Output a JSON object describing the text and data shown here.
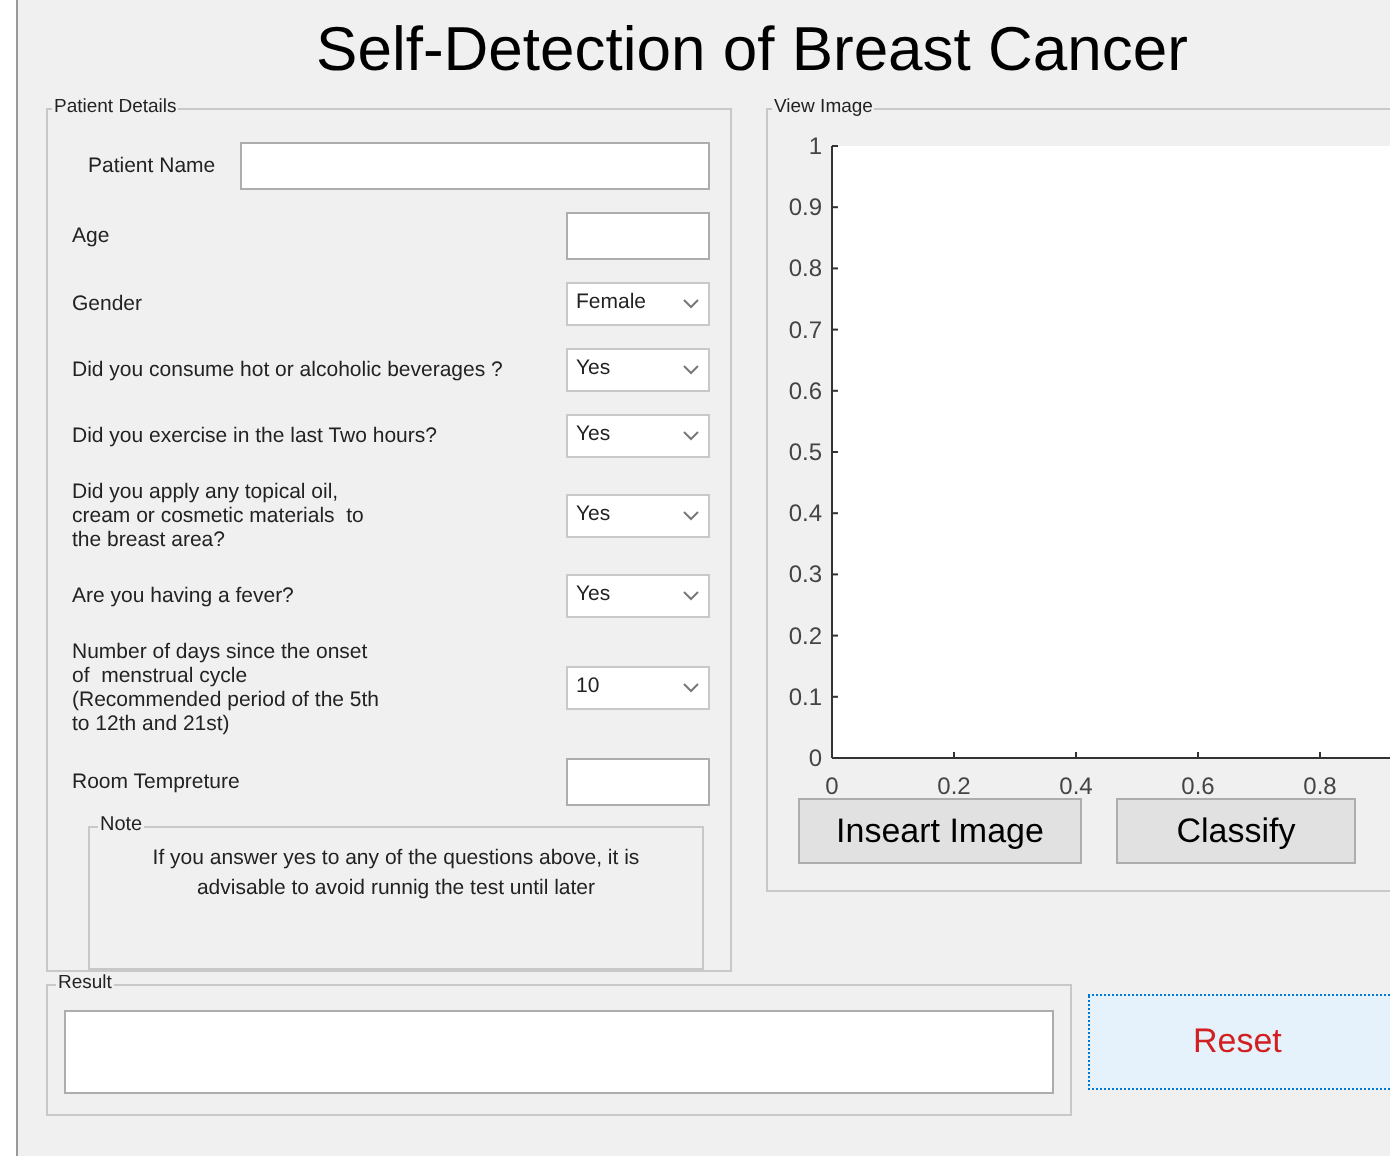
{
  "title": "Self-Detection of Breast Cancer",
  "patient_details": {
    "title": "Patient Details",
    "fields": [
      {
        "kind": "wide_text",
        "label": "Patient Name"
      },
      {
        "kind": "text",
        "label": "Age"
      },
      {
        "kind": "select",
        "label": "Gender",
        "value": "Female"
      },
      {
        "kind": "select",
        "label": "Did you consume hot or alcoholic beverages ?",
        "value": "Yes"
      },
      {
        "kind": "select",
        "label": "Did you exercise in the last Two hours?",
        "value": "Yes"
      },
      {
        "kind": "select",
        "label": "Did you apply any topical oil,\ncream or cosmetic materials  to\nthe breast area?",
        "value": "Yes"
      },
      {
        "kind": "select",
        "label": "Are you having a fever?",
        "value": "Yes"
      },
      {
        "kind": "select",
        "label": "Number of days since the onset\nof  menstrual cycle\n(Recommended period of the 5th\nto 12th and 21st)",
        "value": "10"
      },
      {
        "kind": "text",
        "label": "Room Tempreture"
      }
    ],
    "note": {
      "title": "Note",
      "text": "If you answer yes to any of the questions above, it is advisable to avoid runnig the test until later"
    }
  },
  "view_image": {
    "title": "View Image",
    "chart_data": {
      "type": "line",
      "xlim": [
        0,
        1
      ],
      "ylim": [
        0,
        1
      ],
      "xticks": [
        0,
        0.2,
        0.4,
        0.6,
        0.8
      ],
      "yticks": [
        0,
        0.1,
        0.2,
        0.3,
        0.4,
        0.5,
        0.6,
        0.7,
        0.8,
        0.9,
        1
      ]
    },
    "buttons": [
      "Inseart Image",
      "Classify"
    ]
  },
  "result": {
    "title": "Result"
  },
  "reset_button": "Reset"
}
